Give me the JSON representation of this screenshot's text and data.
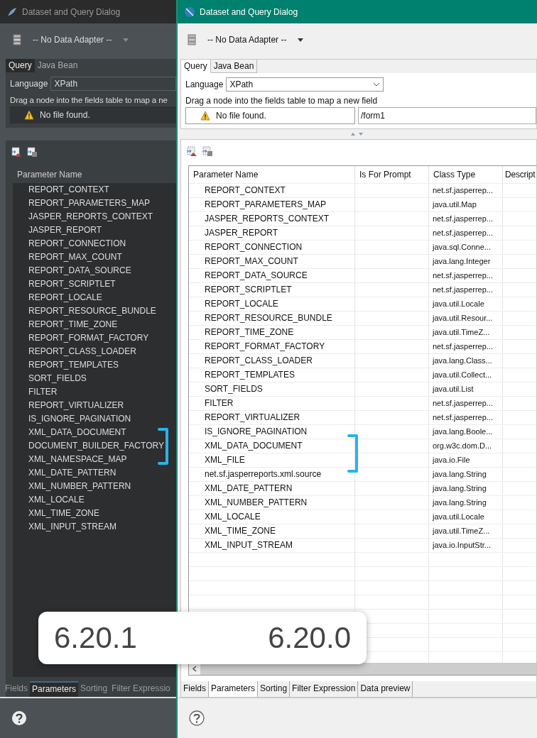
{
  "dialogs": [
    {
      "kind": "dark",
      "title": "Dataset and Query Dialog",
      "adapter": "-- No Data Adapter --",
      "query_tabs": [
        {
          "label": "Query",
          "selected": true
        },
        {
          "label": "Java Bean",
          "selected": false
        }
      ],
      "language_label": "Language",
      "language": "XPath",
      "hint": "Drag a node into the fields table to map a ne",
      "message": "No file found.",
      "columns": [
        "Parameter Name"
      ],
      "rows": [
        {
          "name": "REPORT_CONTEXT"
        },
        {
          "name": "REPORT_PARAMETERS_MAP"
        },
        {
          "name": "JASPER_REPORTS_CONTEXT"
        },
        {
          "name": "JASPER_REPORT"
        },
        {
          "name": "REPORT_CONNECTION"
        },
        {
          "name": "REPORT_MAX_COUNT"
        },
        {
          "name": "REPORT_DATA_SOURCE"
        },
        {
          "name": "REPORT_SCRIPTLET"
        },
        {
          "name": "REPORT_LOCALE"
        },
        {
          "name": "REPORT_RESOURCE_BUNDLE"
        },
        {
          "name": "REPORT_TIME_ZONE"
        },
        {
          "name": "REPORT_FORMAT_FACTORY"
        },
        {
          "name": "REPORT_CLASS_LOADER"
        },
        {
          "name": "REPORT_TEMPLATES"
        },
        {
          "name": "SORT_FIELDS"
        },
        {
          "name": "FILTER"
        },
        {
          "name": "REPORT_VIRTUALIZER"
        },
        {
          "name": "IS_IGNORE_PAGINATION"
        },
        {
          "name": "XML_DATA_DOCUMENT"
        },
        {
          "name": "DOCUMENT_BUILDER_FACTORY"
        },
        {
          "name": "XML_NAMESPACE_MAP"
        },
        {
          "name": "XML_DATE_PATTERN"
        },
        {
          "name": "XML_NUMBER_PATTERN"
        },
        {
          "name": "XML_LOCALE"
        },
        {
          "name": "XML_TIME_ZONE"
        },
        {
          "name": "XML_INPUT_STREAM"
        }
      ],
      "bottom_tabs": [
        {
          "label": "Fields",
          "selected": false
        },
        {
          "label": "Parameters",
          "selected": true
        },
        {
          "label": "Sorting",
          "selected": false
        },
        {
          "label": "Filter Expressio",
          "selected": false
        }
      ]
    },
    {
      "kind": "light",
      "title": "Dataset and Query Dialog",
      "adapter": "-- No Data Adapter --",
      "query_tabs": [
        {
          "label": "Query",
          "selected": true
        },
        {
          "label": "Java Bean",
          "selected": false
        }
      ],
      "language_label": "Language",
      "language": "XPath",
      "hint": "Drag a node into the fields table to map a new field",
      "message": "No file found.",
      "path": "/form1",
      "columns": [
        "Parameter Name",
        "Is For Prompt",
        "Class Type",
        "Descript"
      ],
      "rows": [
        {
          "name": "REPORT_CONTEXT",
          "class_type": "net.sf.jasperrep..."
        },
        {
          "name": "REPORT_PARAMETERS_MAP",
          "class_type": "java.util.Map"
        },
        {
          "name": "JASPER_REPORTS_CONTEXT",
          "class_type": "net.sf.jasperrep..."
        },
        {
          "name": "JASPER_REPORT",
          "class_type": "net.sf.jasperrep..."
        },
        {
          "name": "REPORT_CONNECTION",
          "class_type": "java.sql.Conne..."
        },
        {
          "name": "REPORT_MAX_COUNT",
          "class_type": "java.lang.Integer"
        },
        {
          "name": "REPORT_DATA_SOURCE",
          "class_type": "net.sf.jasperrep..."
        },
        {
          "name": "REPORT_SCRIPTLET",
          "class_type": "net.sf.jasperrep..."
        },
        {
          "name": "REPORT_LOCALE",
          "class_type": "java.util.Locale"
        },
        {
          "name": "REPORT_RESOURCE_BUNDLE",
          "class_type": "java.util.Resour..."
        },
        {
          "name": "REPORT_TIME_ZONE",
          "class_type": "java.util.TimeZ..."
        },
        {
          "name": "REPORT_FORMAT_FACTORY",
          "class_type": "net.sf.jasperrep..."
        },
        {
          "name": "REPORT_CLASS_LOADER",
          "class_type": "java.lang.Class..."
        },
        {
          "name": "REPORT_TEMPLATES",
          "class_type": "java.util.Collect..."
        },
        {
          "name": "SORT_FIELDS",
          "class_type": "java.util.List"
        },
        {
          "name": "FILTER",
          "class_type": "net.sf.jasperrep..."
        },
        {
          "name": "REPORT_VIRTUALIZER",
          "class_type": "net.sf.jasperrep..."
        },
        {
          "name": "IS_IGNORE_PAGINATION",
          "class_type": "java.lang.Boole..."
        },
        {
          "name": "XML_DATA_DOCUMENT",
          "class_type": "org.w3c.dom.D..."
        },
        {
          "name": "XML_FILE",
          "class_type": "java.io.File"
        },
        {
          "name": "net.sf.jasperreports.xml.source",
          "class_type": "java.lang.String"
        },
        {
          "name": "XML_DATE_PATTERN",
          "class_type": "java.lang.String"
        },
        {
          "name": "XML_NUMBER_PATTERN",
          "class_type": "java.lang.String"
        },
        {
          "name": "XML_LOCALE",
          "class_type": "java.util.Locale"
        },
        {
          "name": "XML_TIME_ZONE",
          "class_type": "java.util.TimeZ..."
        },
        {
          "name": "XML_INPUT_STREAM",
          "class_type": "java.io.InputStr..."
        }
      ],
      "bottom_tabs": [
        {
          "label": "Fields",
          "selected": false
        },
        {
          "label": "Parameters",
          "selected": true
        },
        {
          "label": "Sorting",
          "selected": false
        },
        {
          "label": "Filter Expression",
          "selected": false
        },
        {
          "label": "Data preview",
          "selected": false
        }
      ]
    }
  ],
  "versions": [
    "6.20.1",
    "6.20.0"
  ]
}
